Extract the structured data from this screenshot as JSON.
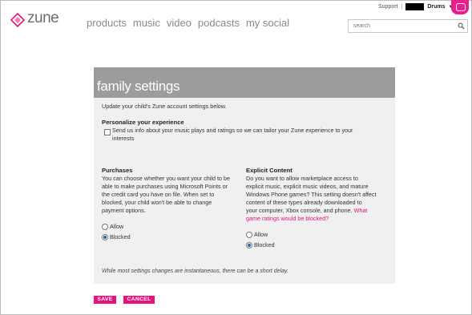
{
  "header": {
    "logo_text": "zune",
    "nav": [
      "products",
      "music",
      "video",
      "podcasts",
      "my social"
    ],
    "top_links": {
      "support": "Support",
      "separator": "|",
      "user": "Drums",
      "caret": "▼"
    },
    "search": {
      "placeholder": "search",
      "value": ""
    },
    "colors": {
      "brand": "#e8127e",
      "nav_text": "#8a8a8a"
    }
  },
  "panel": {
    "title": "family settings",
    "intro": "Update your child's Zune account settings below.",
    "personalize": {
      "heading": "Personalize your experience",
      "checkbox_label_line1": "Send us info about your music plays and ratings so we can tailor your Zune experience to your",
      "checkbox_label_line2": "interests",
      "checked": false
    },
    "purchases": {
      "heading": "Purchases",
      "lines": [
        "You can choose whether you want your child to be",
        "able to make purchases using Microsoft Points or",
        "the credit card you have on file. When set to",
        "blocked, your child won't be able to change",
        "payment options."
      ],
      "options": [
        "Allow",
        "Blocked"
      ],
      "selected": "Blocked"
    },
    "explicit": {
      "heading": "Explicit Content",
      "lines": [
        "Do you want to allow marketplace access to",
        "explicit music, explicit music videos, and mature",
        "Windows Phone games? This setting doesn't affect",
        "content of these types already downloaded to",
        "your computer, Xbox console, and phone."
      ],
      "link_part1": "What",
      "link_part2": "game ratings would be blocked?",
      "options": [
        "Allow",
        "Blocked"
      ],
      "selected": "Blocked"
    },
    "footnote": "While most settings changes are instantaneous, there can be a short delay."
  },
  "actions": {
    "save": "SAVE",
    "cancel": "CANCEL"
  }
}
